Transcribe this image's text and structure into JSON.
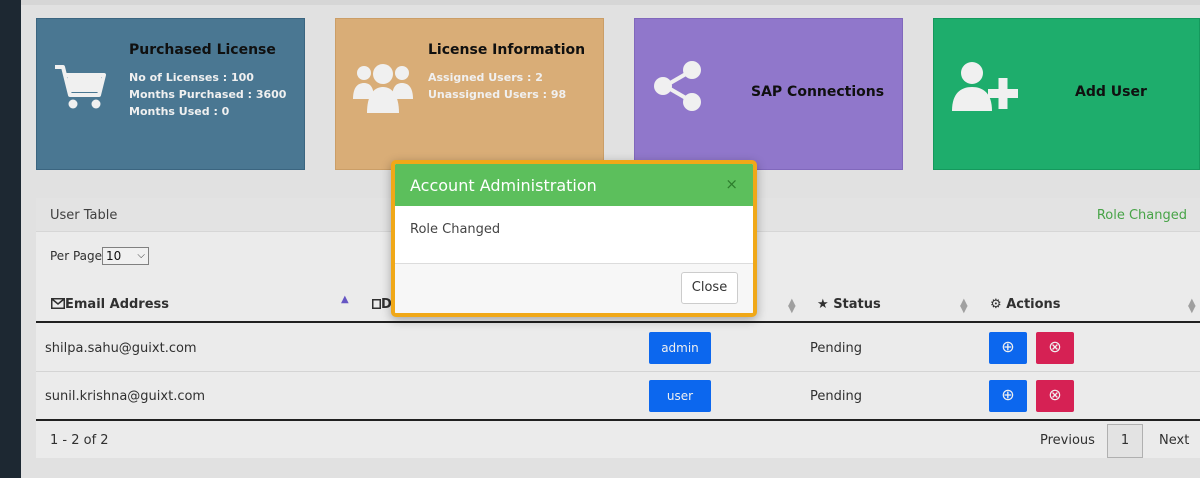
{
  "cards": {
    "purchased": {
      "title": "Purchased License",
      "line1": "No of Licenses : 100",
      "line2": "Months Purchased : 3600",
      "line3": "Months Used : 0",
      "icon": "shopping-cart-icon"
    },
    "license_info": {
      "title": "License Information",
      "line1": "Assigned Users : 2",
      "line2": "Unassigned Users : 98",
      "icon": "users-group-icon"
    },
    "sap": {
      "title": "SAP Connections",
      "icon": "share-icon"
    },
    "add_user": {
      "title": "Add User",
      "icon": "user-plus-icon"
    }
  },
  "table": {
    "title": "User Table",
    "status_text": "Role Changed",
    "per_page_label": "Per Page",
    "per_page_value": "10",
    "columns": {
      "email": "Email Address",
      "d_partial": "D",
      "status": "Status",
      "actions": "Actions"
    },
    "rows": [
      {
        "email": "shilpa.sahu@guixt.com",
        "role": "admin",
        "status": "Pending"
      },
      {
        "email": "sunil.krishna@guixt.com",
        "role": "user",
        "status": "Pending"
      }
    ],
    "range": "1 - 2 of 2",
    "prev": "Previous",
    "page": "1",
    "next": "Next"
  },
  "modal": {
    "title": "Account Administration",
    "close_x": "×",
    "message": "Role Changed",
    "close_button": "Close"
  }
}
